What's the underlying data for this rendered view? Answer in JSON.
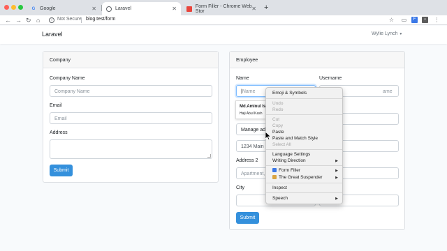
{
  "browser": {
    "tabs": [
      {
        "title": "Google",
        "icon": "google-favicon"
      },
      {
        "title": "Laravel",
        "icon": "globe-favicon"
      },
      {
        "title": "Form Filler - Chrome Web Stor",
        "icon": "chrome-web-store-favicon"
      }
    ],
    "security_label": "Not Secure",
    "url": "blog.test/form"
  },
  "app": {
    "brand": "Laravel",
    "user": "Wylie Lynch"
  },
  "company": {
    "header": "Company",
    "name_label": "Company Name",
    "name_placeholder": "Company Name",
    "email_label": "Email",
    "email_placeholder": "Email",
    "address_label": "Address",
    "submit": "Submit"
  },
  "employee": {
    "header": "Employee",
    "name_label": "Name",
    "name_placeholder": "Name",
    "username_label": "Username",
    "username_partial": "ame",
    "field_manage_partial": "Manage addr",
    "address_value_partial": "1234 Main S",
    "address2_label": "Address 2",
    "address2_partial": "Apartment,",
    "city_label": "City",
    "submit": "Submit"
  },
  "autofill": {
    "name": "Md.Aminul Is",
    "address": "Haji Abul Kash"
  },
  "context_menu": {
    "emoji": "Emoji & Symbols",
    "undo": "Undo",
    "redo": "Redo",
    "cut": "Cut",
    "copy": "Copy",
    "paste": "Paste",
    "paste_match": "Paste and Match Style",
    "select_all": "Select All",
    "language": "Language Settings",
    "writing": "Writing Direction",
    "form_filler": "Form Filler",
    "great_suspender": "The Great Suspender",
    "inspect": "Inspect",
    "speech": "Speech"
  },
  "colors": {
    "primary": "#3490dc",
    "page_bg": "#f8fafc"
  }
}
